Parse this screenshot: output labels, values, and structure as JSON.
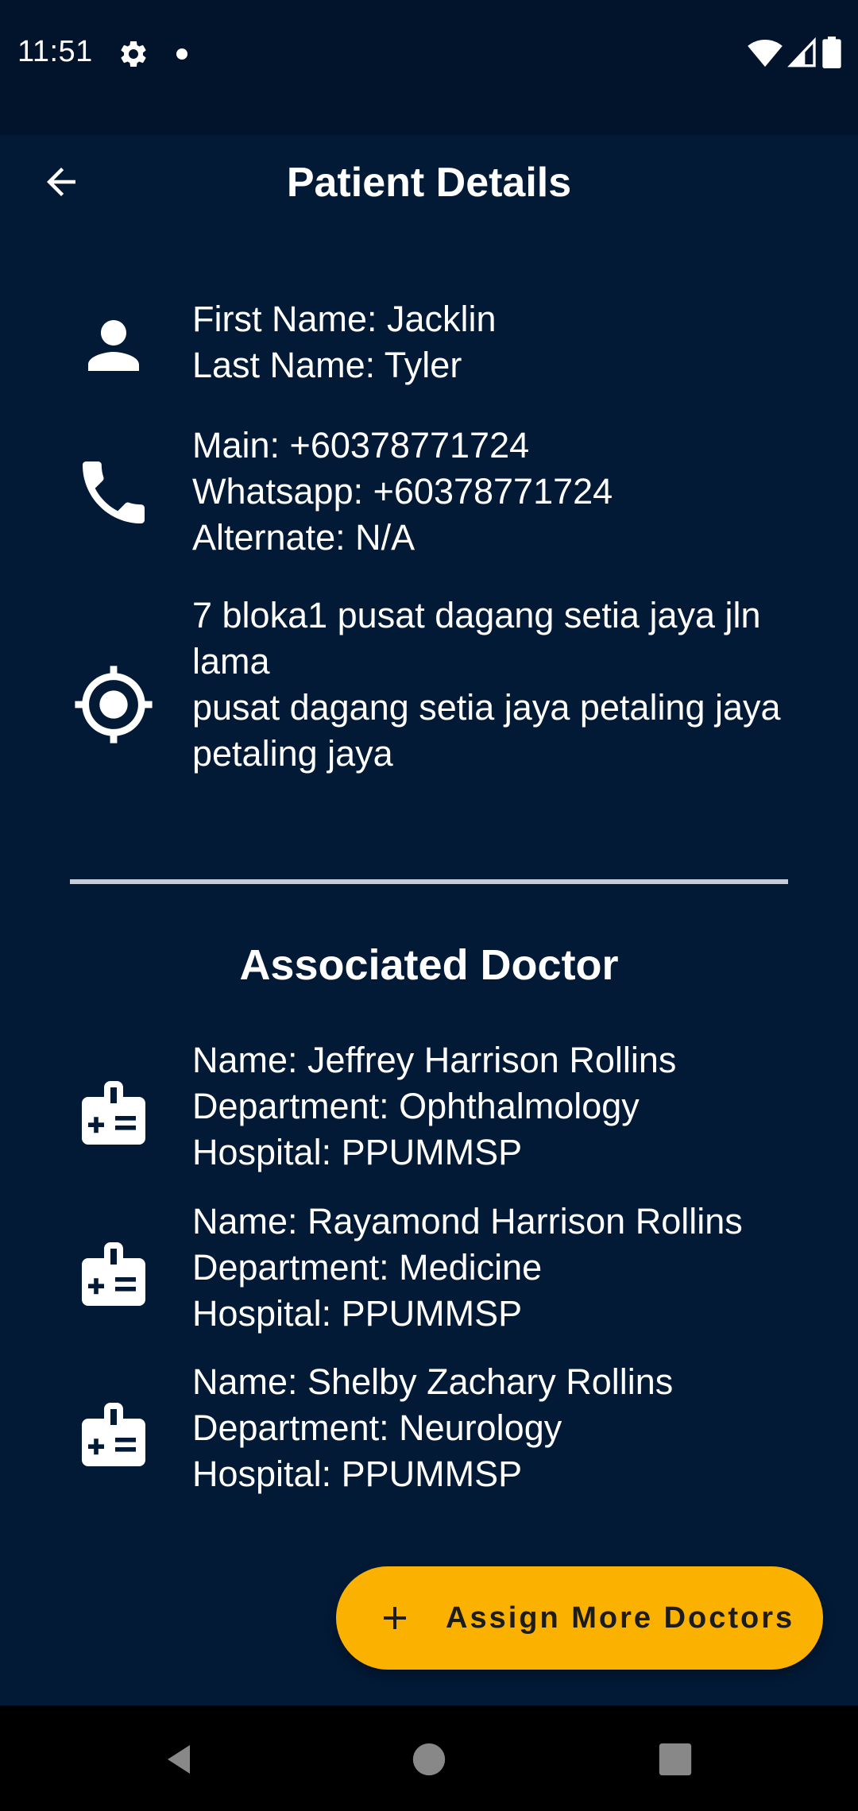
{
  "status_bar": {
    "time": "11:51"
  },
  "app_bar": {
    "title": "Patient Details"
  },
  "patient": {
    "first_name": "First Name: Jacklin",
    "last_name": "Last Name: Tyler",
    "main_phone": "Main: +60378771724",
    "whatsapp": "Whatsapp: +60378771724",
    "alternate": "Alternate: N/A",
    "address_lines": [
      "7 bloka1 pusat dagang setia jaya jln lama",
      "pusat dagang setia jaya petaling jaya",
      "petaling jaya"
    ]
  },
  "section": {
    "title": "Associated Doctor"
  },
  "doctors": [
    {
      "name": "Name: Jeffrey Harrison Rollins",
      "department": "Department: Ophthalmology",
      "hospital": "Hospital: PPUMMSP"
    },
    {
      "name": "Name: Rayamond Harrison Rollins",
      "department": "Department: Medicine",
      "hospital": "Hospital: PPUMMSP"
    },
    {
      "name": "Name: Shelby Zachary Rollins",
      "department": "Department: Neurology",
      "hospital": "Hospital: PPUMMSP"
    }
  ],
  "fab": {
    "label": "Assign More Doctors",
    "icon": "plus-icon"
  },
  "colors": {
    "background": "#021a36",
    "status_bar": "#02142b",
    "accent": "#fbb100",
    "divider": "#c7cdd6"
  }
}
